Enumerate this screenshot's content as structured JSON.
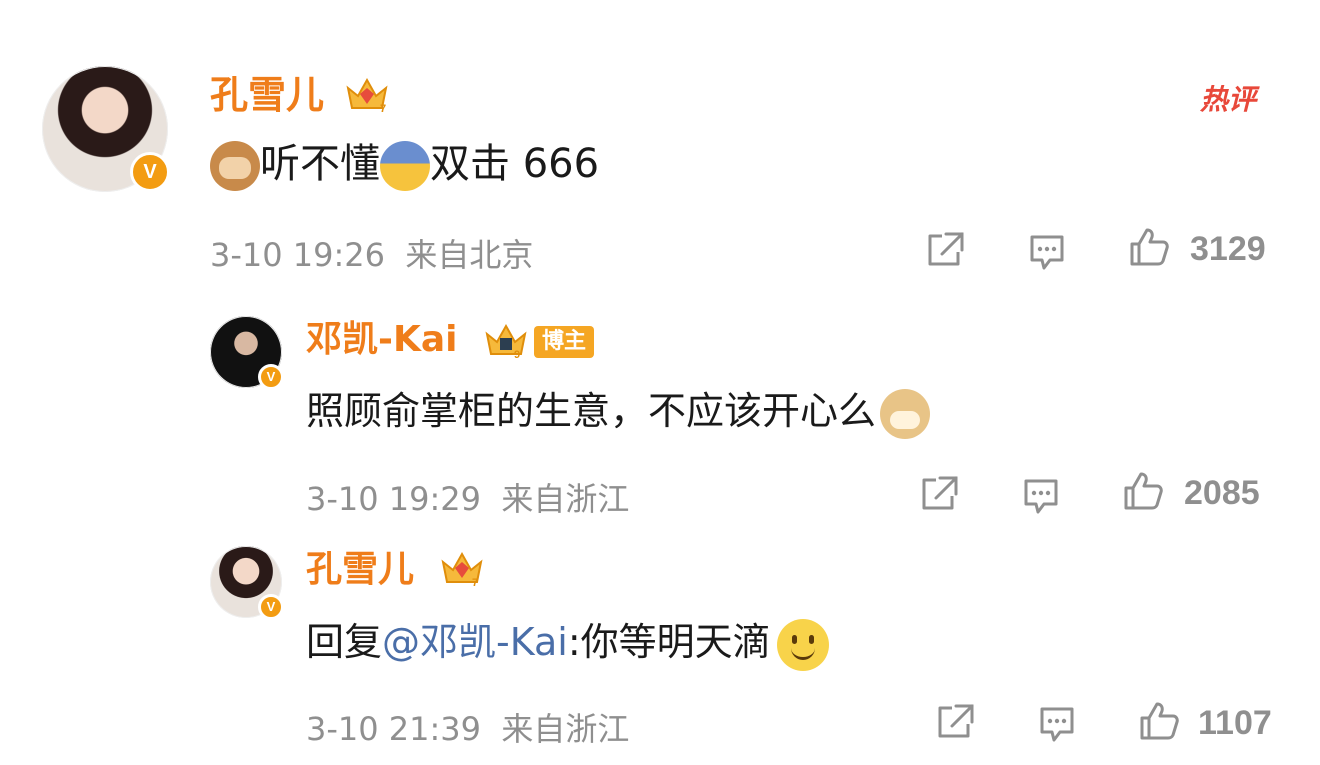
{
  "comments": [
    {
      "user_name": "孔雪儿",
      "hot_tag": "热评",
      "text_parts": [
        "听不懂",
        "双击 666"
      ],
      "emojis": [
        "see-no-evil-monkey-icon",
        "fearful-face-icon"
      ],
      "time": "3-10 19:26",
      "location": "来自北京",
      "likes": "3129",
      "level_badge": "7"
    },
    {
      "user_name": "邓凯-Kai",
      "badge_label": "博主",
      "level_badge": "9",
      "text": "照顾俞掌柜的生意，不应该开心么",
      "emoji": "doge-icon",
      "time": "3-10 19:29",
      "location": "来自浙江",
      "likes": "2085"
    },
    {
      "user_name": "孔雪儿",
      "level_badge": "7",
      "reply_prefix": "回复",
      "mention": "@邓凯-Kai",
      "text": ":你等明天滴",
      "emoji": "smile-face-icon",
      "time": "3-10 21:39",
      "location": "来自浙江",
      "likes": "1107"
    }
  ],
  "colors": {
    "name": "#ef7d1a",
    "hot": "#e8483a",
    "meta": "#8f8f8f",
    "mention": "#4a6ea8",
    "verified": "#f39c12"
  }
}
